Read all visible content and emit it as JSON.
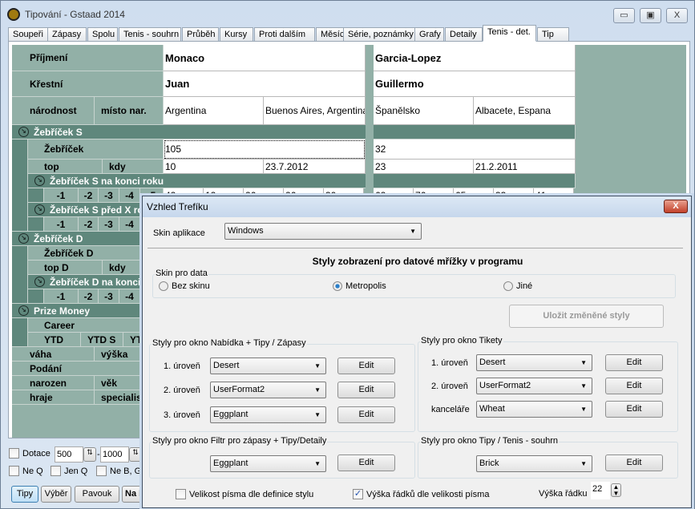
{
  "window": {
    "title": "Tipování - Gstaad 2014",
    "minimize": "▭",
    "maximize": "▣",
    "close": "X"
  },
  "tabs": [
    "Soupeři",
    "Zápasy",
    "Spolu",
    "Tenis - souhrn",
    "Průběh",
    "Kursy",
    "Proti dalším",
    "Měsíce",
    "Série, poznámky",
    "Grafy",
    "Detaily",
    "Tenis - det.",
    "Tip"
  ],
  "active_tab": "Tenis - det.",
  "grid": {
    "labels": {
      "prijmeni": "Příjmení",
      "krestni": "Křestní",
      "narodnost": "národnost",
      "misto": "místo nar.",
      "zebricek_s": "Žebříček S",
      "zebricek": "Žebříček",
      "top": "top",
      "kdy": "kdy",
      "s_konec": "Žebříček S na konci roku",
      "s_pred": "Žebříček S před X rok",
      "zebricek_d": "Žebříček D",
      "zebricek_d2": "Žebříček D",
      "top_d": "top D",
      "kdy_d": "kdy",
      "d_konec": "Žebříček D na konci ro",
      "prize": "Prize Money",
      "career": "Career",
      "ytd": "YTD",
      "ytds": "YTD S",
      "ytdx": "YT",
      "vaha": "váha",
      "vyska": "výška",
      "podani": "Podání",
      "narozen": "narozen",
      "vek": "věk",
      "hraje": "hraje",
      "specialista": "specialist"
    },
    "years": [
      "-1",
      "-2",
      "-3",
      "-4",
      "-5"
    ],
    "player1": {
      "surname": "Monaco",
      "first": "Juan",
      "nationality": "Argentina",
      "birthplace": "Buenos Aires, Argentina",
      "rank": "105",
      "top": "10",
      "top_date": "23.7.2012",
      "year_end": [
        "42",
        "12",
        "26",
        "26",
        "30"
      ]
    },
    "player2": {
      "surname": "Garcia-Lopez",
      "first": "Guillermo",
      "nationality": "Španělsko",
      "birthplace": "Albacete, Espana",
      "rank": "32",
      "top": "23",
      "top_date": "21.2.2011",
      "year_end": [
        "62",
        "76",
        "65",
        "33",
        "41"
      ]
    }
  },
  "bottom": {
    "dotace": "Dotace",
    "from": "500",
    "to": "1000",
    "dash": "-",
    "neq": "Ne Q",
    "jenq": "Jen Q",
    "nebg": "Ne B, G",
    "buttons": [
      "Tipy",
      "Výběr",
      "Pavouk",
      "Na b"
    ]
  },
  "colors": {
    "header": "#5f877c",
    "cell": "#92b0a7"
  },
  "dialog": {
    "title": "Vzhled Trefíku",
    "close": "X",
    "skin_label": "Skin aplikace",
    "skin_value": "Windows",
    "heading": "Styly zobrazení pro datové mřížky v programu",
    "skin_data": {
      "label": "Skin pro data",
      "options": [
        "Bez skinu",
        "Metropolis",
        "Jiné"
      ],
      "selected": "Metropolis"
    },
    "save": "Uložit změněné styly",
    "g1": {
      "title": "Styly pro okno Nabídka + Tipy / Zápasy",
      "rows": [
        {
          "label": "1. úroveň",
          "value": "Desert"
        },
        {
          "label": "2. úroveň",
          "value": "UserFormat2"
        },
        {
          "label": "3. úroveň",
          "value": "Eggplant"
        }
      ]
    },
    "g2": {
      "title": "Styly pro okno Tikety",
      "rows": [
        {
          "label": "1. úroveň",
          "value": "Desert"
        },
        {
          "label": "2. úroveň",
          "value": "UserFormat2"
        },
        {
          "label": "kanceláře",
          "value": "Wheat"
        }
      ]
    },
    "g3": {
      "title": "Styly pro okno Filtr pro zápasy + Tipy/Detaily",
      "value": "Eggplant"
    },
    "g4": {
      "title": "Styly pro okno Tipy / Tenis - souhrn",
      "value": "Brick"
    },
    "edit": "Edit",
    "font_size": {
      "label": "Velikost písma dle definice stylu",
      "checked": false
    },
    "row_height_font": {
      "label": "Výška řádků dle velikosti písma",
      "checked": true
    },
    "row_height": {
      "label": "Výška řádku",
      "value": "22"
    }
  }
}
